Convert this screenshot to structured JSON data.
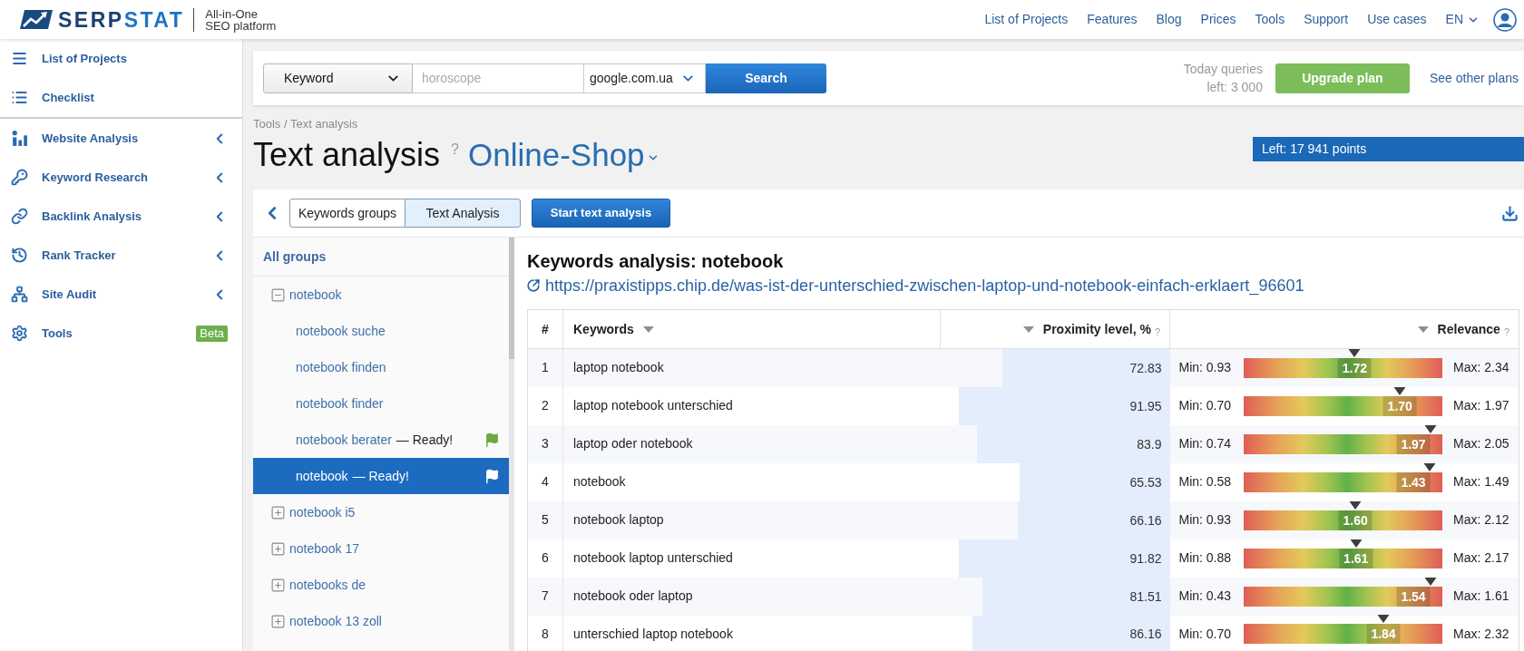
{
  "header": {
    "logo": {
      "wordmark": [
        "SERP",
        "STAT"
      ],
      "tagline": [
        "All-in-One",
        "SEO platform"
      ]
    },
    "nav": [
      "List of Projects",
      "Features",
      "Blog",
      "Prices",
      "Tools",
      "Support",
      "Use cases"
    ],
    "language": "EN"
  },
  "sidebar": {
    "sections": [
      {
        "items": [
          {
            "label": "List of Projects",
            "kind": "link"
          },
          {
            "label": "Checklist",
            "kind": "link"
          }
        ]
      },
      {
        "items": [
          {
            "label": "Website Analysis",
            "kind": "group"
          },
          {
            "label": "Keyword Research",
            "kind": "group"
          },
          {
            "label": "Backlink Analysis",
            "kind": "group"
          },
          {
            "label": "Rank Tracker",
            "kind": "group"
          },
          {
            "label": "Site Audit",
            "kind": "group"
          },
          {
            "label": "Tools",
            "kind": "link",
            "badge": "Beta"
          }
        ]
      }
    ]
  },
  "search": {
    "type": "Keyword",
    "query": {
      "placeholder": "horoscope"
    },
    "database": "google.com.ua",
    "button": "Search",
    "quota": [
      "Today queries",
      "left: 3 000"
    ],
    "upgrade_button": "Upgrade plan",
    "plans_link": "See other plans"
  },
  "breadcrumb": "Tools / Text analysis",
  "page": {
    "title": "Text analysis",
    "help": "?",
    "project": "Online-Shop",
    "points": "Left: 17 941 points"
  },
  "toolbar": {
    "tabs": [
      {
        "label": "Keywords groups",
        "selected": false
      },
      {
        "label": "Text Analysis",
        "selected": true
      }
    ],
    "start_button": "Start text analysis"
  },
  "tree": {
    "header": "All groups",
    "items": [
      {
        "label": "notebook",
        "kind": "group",
        "expanded": true,
        "selected": false,
        "children": [
          {
            "label": "notebook suche",
            "kind": "leaf",
            "selected": false
          },
          {
            "label": "notebook finden",
            "kind": "leaf",
            "selected": false
          },
          {
            "label": "notebook finder",
            "kind": "leaf",
            "selected": false
          },
          {
            "label": "notebook berater",
            "status": "— Ready!",
            "kind": "leaf",
            "selected": false
          },
          {
            "label": "notebook",
            "status": "— Ready!",
            "kind": "leaf",
            "selected": true
          }
        ]
      },
      {
        "label": "notebook i5",
        "kind": "group",
        "expanded": false,
        "selected": false
      },
      {
        "label": "notebook 17",
        "kind": "group",
        "expanded": false,
        "selected": false
      },
      {
        "label": "notebooks de",
        "kind": "group",
        "expanded": false,
        "selected": false
      },
      {
        "label": "notebook 13 zoll",
        "kind": "group",
        "expanded": false,
        "selected": false
      }
    ]
  },
  "analysis": {
    "title": "Keywords analysis: notebook",
    "url": "https://praxistipps.chip.de/was-ist-der-unterschied-zwischen-laptop-und-notebook-einfach-erklaert_96601",
    "table": {
      "columns": [
        {
          "label": "#",
          "sortable": false
        },
        {
          "label": "Keywords",
          "sortable": true
        },
        {
          "label": "Proximity level, %",
          "sortable": true,
          "help": "?"
        },
        {
          "label": "Relevance",
          "sortable": true,
          "help": "?"
        }
      ],
      "rows": [
        {
          "index": "1",
          "keyword": "laptop notebook",
          "proximity": {
            "value": "72.83",
            "level": 0.7283
          },
          "relevance": {
            "min": "Min: 0.93",
            "value": "1.72",
            "max": "Max: 2.34",
            "level": 0.56
          }
        },
        {
          "index": "2",
          "keyword": "laptop notebook unterschied",
          "proximity": {
            "value": "91.95",
            "level": 0.9195
          },
          "relevance": {
            "min": "Min: 0.70",
            "value": "1.70",
            "max": "Max: 1.97",
            "level": 0.787
          }
        },
        {
          "index": "3",
          "keyword": "laptop oder notebook",
          "proximity": {
            "value": "83.9",
            "level": 0.839
          },
          "relevance": {
            "min": "Min: 0.74",
            "value": "1.97",
            "max": "Max: 2.05",
            "level": 0.939
          }
        },
        {
          "index": "4",
          "keyword": "notebook",
          "proximity": {
            "value": "65.53",
            "level": 0.6553
          },
          "relevance": {
            "min": "Min: 0.58",
            "value": "1.43",
            "max": "Max: 1.49",
            "level": 0.934
          }
        },
        {
          "index": "5",
          "keyword": "notebook laptop",
          "proximity": {
            "value": "66.16",
            "level": 0.6616
          },
          "relevance": {
            "min": "Min: 0.93",
            "value": "1.60",
            "max": "Max: 2.12",
            "level": 0.563
          }
        },
        {
          "index": "6",
          "keyword": "notebook laptop unterschied",
          "proximity": {
            "value": "91.82",
            "level": 0.9182
          },
          "relevance": {
            "min": "Min: 0.88",
            "value": "1.61",
            "max": "Max: 2.17",
            "level": 0.566
          }
        },
        {
          "index": "7",
          "keyword": "notebook oder laptop",
          "proximity": {
            "value": "81.51",
            "level": 0.8151
          },
          "relevance": {
            "min": "Min: 0.43",
            "value": "1.54",
            "max": "Max: 1.61",
            "level": 0.941
          }
        },
        {
          "index": "8",
          "keyword": "unterschied laptop notebook",
          "proximity": {
            "value": "86.16",
            "level": 0.8616
          },
          "relevance": {
            "min": "Min: 0.70",
            "value": "1.84",
            "max": "Max: 2.32",
            "level": 0.704
          }
        }
      ]
    }
  }
}
